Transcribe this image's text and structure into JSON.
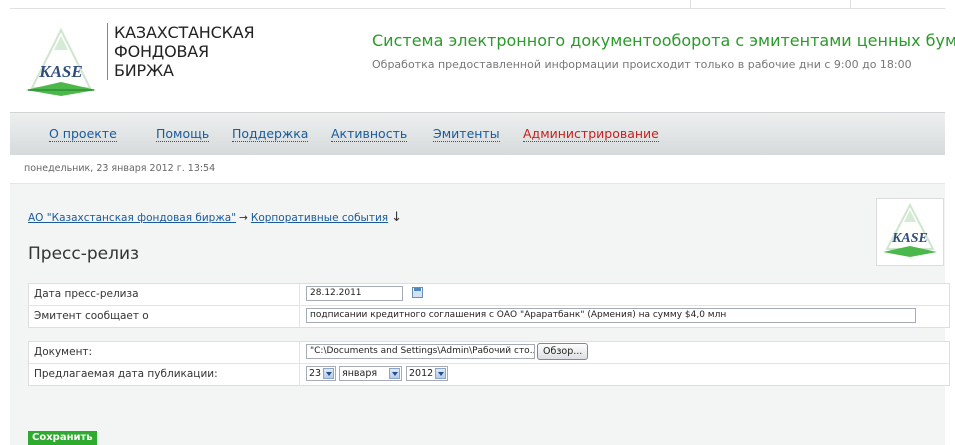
{
  "logo": {
    "wordmark": "KASE",
    "name_lines": [
      "КАЗАХСТАНСКАЯ",
      "ФОНДОВАЯ",
      "БИРЖА"
    ]
  },
  "header": {
    "title": "Система электронного документооборота с эмитентами ценных бумаг",
    "subtitle": "Обработка предоставленной информации происходит только в рабочие дни с 9:00 до 18:00"
  },
  "nav": {
    "items": [
      {
        "label": "О проекте"
      },
      {
        "label": "Помощь"
      },
      {
        "label": "Поддержка"
      },
      {
        "label": "Активность"
      },
      {
        "label": "Эмитенты"
      },
      {
        "label": "Администрирование"
      }
    ]
  },
  "date_text": "понедельник, 23 января 2012 г. 13:54",
  "breadcrumb": {
    "items": [
      "АО \"Казахстанская фондовая биржа\"",
      "Корпоративные события"
    ],
    "separator": "→",
    "down_icon": "↓"
  },
  "page_title": "Пресс-релиз",
  "form1": {
    "release_date_label": "Дата пресс-релиза",
    "release_date_value": "28.12.2011",
    "issuer_label": "Эмитент сообщает о",
    "issuer_value": "подписании кредитного соглашения с ОАО \"Араратбанк\" (Армения) на сумму $4,0 млн"
  },
  "form2": {
    "document_label": "Документ:",
    "document_value": "\"C:\\Documents and Settings\\Admin\\Рабочий сто...",
    "browse_label": "Обзор...",
    "pub_date_label": "Предлагаемая дата публикации:",
    "day": "23",
    "month": "января",
    "year": "2012"
  },
  "save_label": "Сохранить",
  "colors": {
    "accent_green": "#2eaa2e",
    "link_blue": "#1a5a9a",
    "admin_red": "#c82020"
  }
}
